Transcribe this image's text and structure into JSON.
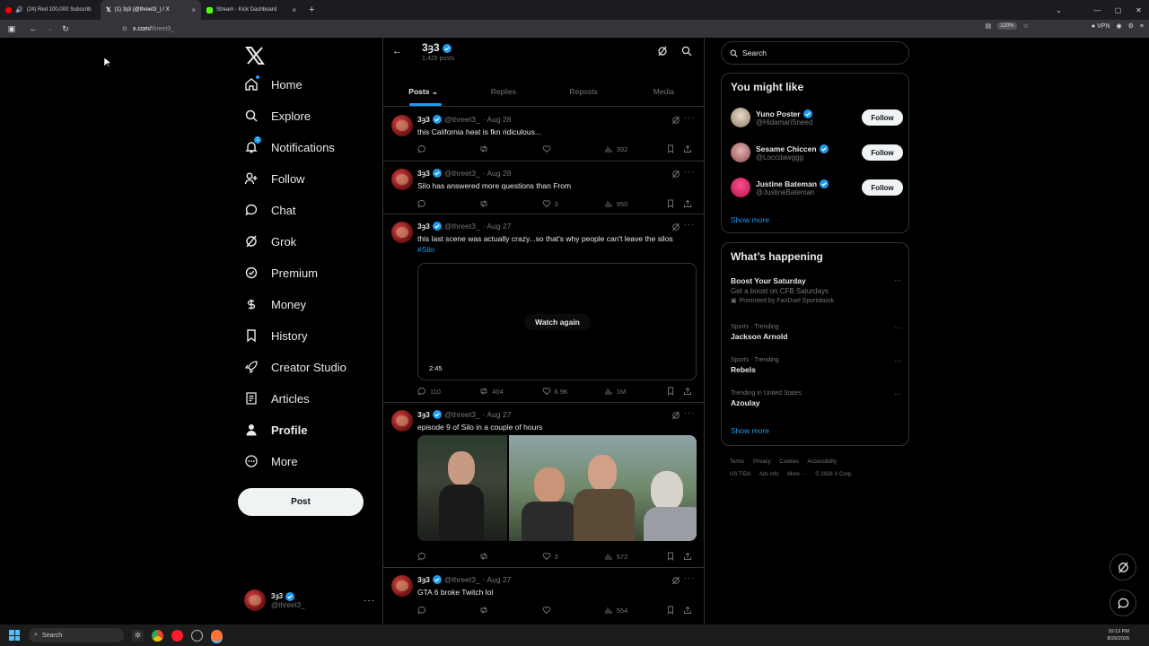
{
  "browser": {
    "tabs": [
      {
        "label": "(24) Red 100,000 Subscrib",
        "active": false,
        "color": "#ff0000"
      },
      {
        "label": "(1) 3ȝ3 (@threet3_) / X",
        "active": true,
        "color": "#ffffff"
      },
      {
        "label": "Stream - Kick Dashboard",
        "active": false,
        "color": "#53fc18"
      }
    ],
    "new_tab": "+",
    "url_domain": "x.com/",
    "url_path": "threet3_",
    "zoom": "120%",
    "vpn": "VPN"
  },
  "nav": {
    "items": [
      {
        "label": "Home",
        "icon": "home-icon"
      },
      {
        "label": "Explore",
        "icon": "search-icon"
      },
      {
        "label": "Notifications",
        "icon": "bell-icon",
        "badge": "1"
      },
      {
        "label": "Follow",
        "icon": "add-person-icon"
      },
      {
        "label": "Chat",
        "icon": "chat-bubble-icon"
      },
      {
        "label": "Grok",
        "icon": "grok-icon"
      },
      {
        "label": "Premium",
        "icon": "premium-icon"
      },
      {
        "label": "Money",
        "icon": "money-icon"
      },
      {
        "label": "History",
        "icon": "bookmark-icon"
      },
      {
        "label": "Creator Studio",
        "icon": "rocket-icon"
      },
      {
        "label": "Articles",
        "icon": "article-icon"
      },
      {
        "label": "Profile",
        "icon": "person-icon"
      },
      {
        "label": "More",
        "icon": "more-circle-icon"
      }
    ],
    "post_button": "Post",
    "account": {
      "name": "3ȝ3",
      "handle": "@threet3_"
    }
  },
  "profile_header": {
    "name": "3ȝ3",
    "post_count": "1,429 posts"
  },
  "profile_tabs": [
    "Posts",
    "Replies",
    "Reposts",
    "Media"
  ],
  "posts": [
    {
      "name": "3ȝ3",
      "handle": "@threet3_",
      "date": "· Aug 28",
      "text": "this California heat is fkn ridiculous...",
      "replies": "",
      "reposts": "",
      "likes": "",
      "views": "392"
    },
    {
      "name": "3ȝ3",
      "handle": "@threet3_",
      "date": "· Aug 28",
      "text": "Silo has answered more questions than From",
      "replies": "",
      "reposts": "",
      "likes": "3",
      "views": "950"
    },
    {
      "name": "3ȝ3",
      "handle": "@threet3_",
      "date": "· Aug 27",
      "text": "this last scene was actually crazy...so that's why people can't leave the silos",
      "hashtag": "#Silo",
      "watch_again": "Watch again",
      "video_time": "2:45",
      "replies": "110",
      "reposts": "404",
      "likes": "6.9K",
      "views": "1M"
    },
    {
      "name": "3ȝ3",
      "handle": "@threet3_",
      "date": "· Aug 27",
      "text": "episode 9 of Silo in a couple of hours",
      "replies": "",
      "reposts": "",
      "likes": "3",
      "views": "572"
    },
    {
      "name": "3ȝ3",
      "handle": "@threet3_",
      "date": "· Aug 27",
      "text": "GTA 6 broke Twitch lol",
      "replies": "",
      "reposts": "",
      "likes": "",
      "views": "554"
    }
  ],
  "sidebar": {
    "search_placeholder": "Search",
    "you_might_like": {
      "title": "You might like",
      "suggestions": [
        {
          "name": "Yuno Poster",
          "handle": "@HidamariSneed",
          "button": "Follow"
        },
        {
          "name": "Sesame Chiccen",
          "handle": "@Loccdawggg",
          "button": "Follow"
        },
        {
          "name": "Justine Bateman",
          "handle": "@JustineBateman",
          "button": "Follow"
        }
      ],
      "show_more": "Show more"
    },
    "whats_happening": {
      "title": "What’s happening",
      "trends": [
        {
          "context": "",
          "title": "Boost Your Saturday",
          "subtitle": "Get a boost on CFB Saturdays",
          "promo": "Promoted by FanDuel Sportsbook"
        },
        {
          "context": "Sports · Trending",
          "title": "Jackson Arnold"
        },
        {
          "context": "Sports · Trending",
          "title": "Rebels"
        },
        {
          "context": "Trending in United States",
          "title": "Azoulay"
        }
      ],
      "show_more": "Show more"
    },
    "footer": {
      "line1": [
        "Terms",
        "Privacy",
        "Cookies",
        "Accessibility"
      ],
      "line2": [
        "US TIDA",
        "Ads info",
        "More ···",
        "© 2026 X Corp."
      ]
    }
  },
  "taskbar": {
    "search": "Search",
    "time": "10:13 PM",
    "date": "8/29/2026"
  },
  "colors": {
    "accent": "#1d9bf0",
    "background": "#000000",
    "border": "#2f3336",
    "muted": "#71767b"
  }
}
